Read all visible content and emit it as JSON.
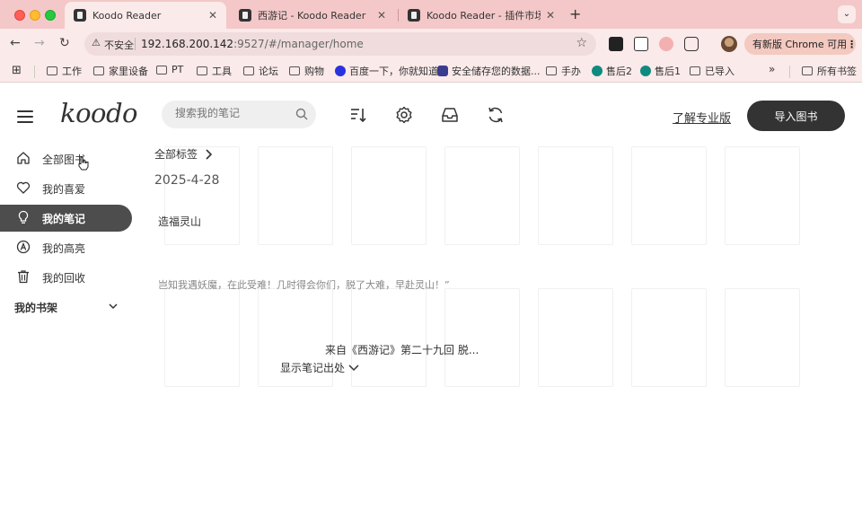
{
  "browser": {
    "tabs": [
      {
        "title": "Koodo Reader",
        "active": true
      },
      {
        "title": "西游记 - Koodo Reader",
        "active": false
      },
      {
        "title": "Koodo Reader - 插件市场",
        "active": false
      }
    ],
    "address": {
      "insecure_label": "不安全",
      "host": "192.168.200.142",
      "path": ":9527/#/manager/home"
    },
    "update_label": "有新版 Chrome 可用",
    "bookmarks": [
      "工作",
      "家里设备",
      "PT",
      "工具",
      "论坛",
      "购物",
      "百度一下，你就知道",
      "安全储存您的数据...",
      "手办",
      "售后2",
      "售后1",
      "已导入"
    ],
    "all_bookmarks_label": "所有书签"
  },
  "app": {
    "logo": "koodo",
    "search_placeholder": "搜索我的笔记",
    "pro_link": "了解专业版",
    "import_button": "导入图书",
    "sidebar": {
      "items": [
        {
          "label": "全部图书",
          "icon": "home-icon",
          "active": false
        },
        {
          "label": "我的喜爱",
          "icon": "heart-icon",
          "active": false
        },
        {
          "label": "我的笔记",
          "icon": "bulb-icon",
          "active": true
        },
        {
          "label": "我的高亮",
          "icon": "highlight-icon",
          "active": false
        },
        {
          "label": "我的回收",
          "icon": "trash-icon",
          "active": false
        }
      ],
      "shelf_label": "我的书架"
    },
    "notes": {
      "tag_header": "全部标签",
      "date": "2025-4-28",
      "note_title": "造福灵山",
      "quote": "岂知我遇妖魔，在此受难！几时得会你们，脱了大难，早赴灵山！”",
      "source": "来自《西游记》第二十九回 脱...",
      "toggle": "显示笔记出处"
    }
  }
}
